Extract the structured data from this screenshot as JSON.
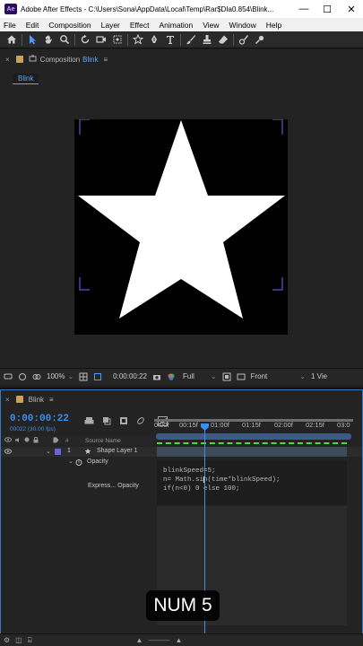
{
  "window": {
    "logo": "Ae",
    "title": "Adobe After Effects - C:\\Users\\Sona\\AppData\\Local\\Temp\\Rar$DIa0.854\\Blink...",
    "minimize": "—",
    "maximize": "☐",
    "close": "✕"
  },
  "menu": [
    "File",
    "Edit",
    "Composition",
    "Layer",
    "Effect",
    "Animation",
    "View",
    "Window",
    "Help"
  ],
  "toolbar": {
    "icons": [
      "home-icon",
      "selection-tool-icon",
      "hand-tool-icon",
      "zoom-tool-icon",
      "rotate-tool-icon",
      "camera-tool-icon",
      "pan-behind-tool-icon",
      "shape-tool-icon",
      "pen-tool-icon",
      "text-tool-icon",
      "brush-tool-icon",
      "clone-stamp-tool-icon",
      "eraser-tool-icon",
      "roto-brush-icon",
      "puppet-pin-icon"
    ]
  },
  "composition_panel": {
    "close": "×",
    "tab_prefix": "Composition",
    "comp_name": "Blink",
    "menu": "≡",
    "breadcrumb": "Blink",
    "zoom": "100%",
    "timecode": "0:00:00:22",
    "resolution": "Full",
    "view": "Front",
    "views_count": "1 Vie"
  },
  "timeline": {
    "close": "×",
    "tab_name": "Blink",
    "menu": "≡",
    "timecode": "0:00:00:22",
    "fps_label": "00022 (30.00 fps)",
    "columns": {
      "label": "#",
      "source_name": "Source Name"
    },
    "ruler_labels": [
      "0:00f",
      "00:15f",
      "01:00f",
      "01:15f",
      "02:00f",
      "02:15f",
      "03:0"
    ],
    "layer": {
      "number": "1",
      "name": "Shape Layer 1",
      "label_color": "#6667d4"
    },
    "property": "Opacity",
    "expression_label": "Express... Opacity",
    "expression_lines": [
      "blinkSpeed=5;",
      "n= Math.sin(time*blinkSpeed);",
      "if(n<0) 0 else 100;"
    ]
  },
  "overlay": {
    "key_label": "NUM 5"
  },
  "colors": {
    "accent": "#3d8ef0",
    "work_area": "#3b5b86",
    "dashed_line": "#3ee43e"
  }
}
